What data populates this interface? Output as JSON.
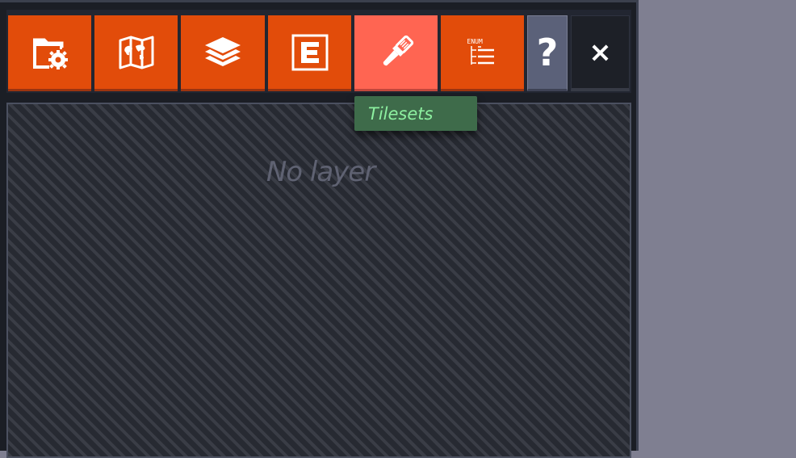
{
  "toolbar": {
    "buttons": [
      {
        "id": "project",
        "icon": "folder-gear-icon",
        "active": false
      },
      {
        "id": "world",
        "icon": "world-map-icon",
        "active": false
      },
      {
        "id": "layers",
        "icon": "layers-icon",
        "active": false
      },
      {
        "id": "entities",
        "icon": "entity-e-icon",
        "active": false
      },
      {
        "id": "tilesets",
        "icon": "paintbrush-icon",
        "active": true
      },
      {
        "id": "enums",
        "icon": "enum-list-icon",
        "active": false
      }
    ],
    "help_label": "?",
    "close_label": "×",
    "enum_icon_text": "ENUM"
  },
  "tooltip": {
    "text": "Tilesets"
  },
  "content": {
    "empty_message": "No layer"
  },
  "colors": {
    "button_orange": "#e24c0a",
    "button_active": "#ff6552",
    "tooltip_bg": "#3e6b4a",
    "tooltip_text": "#8df0a0",
    "page_bg": "#7f7f91"
  }
}
